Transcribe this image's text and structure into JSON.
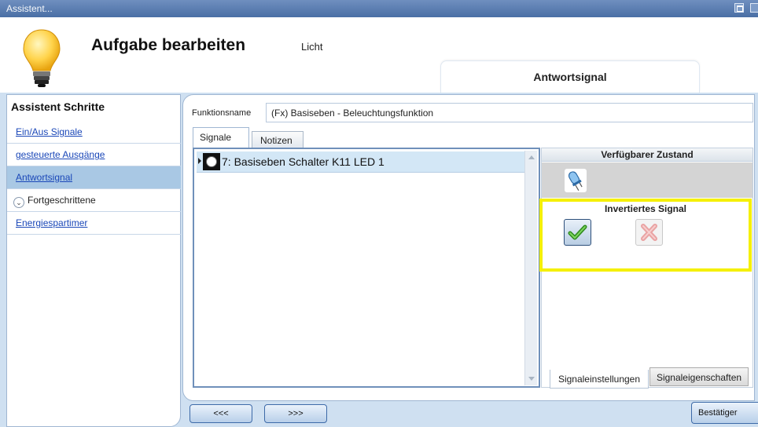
{
  "window": {
    "title": "Assistent..."
  },
  "header": {
    "title": "Aufgabe bearbeiten",
    "subtitle": "Licht",
    "active_step_tab": "Antwortsignal"
  },
  "sidebar": {
    "heading": "Assistent Schritte",
    "items": [
      {
        "label": "Ein/Aus Signale",
        "type": "link"
      },
      {
        "label": "gesteuerte Ausgänge",
        "type": "link"
      },
      {
        "label": "Antwortsignal",
        "type": "link",
        "active": true
      },
      {
        "label": "Fortgeschrittene",
        "type": "expandable",
        "icon": "chevron-down-icon"
      },
      {
        "label": "Energiespartimer",
        "type": "link"
      }
    ]
  },
  "main": {
    "function_name_label": "Funktionsname",
    "function_name_value": "(Fx) Basiseben - Beleuchtungsfunktion",
    "tabs": [
      {
        "label": "Signale",
        "active": true
      },
      {
        "label": "Notizen",
        "active": false
      }
    ],
    "signal_list": [
      {
        "label": "7: Basiseben Schalter K11 LED 1",
        "icon": "led-signal-icon"
      }
    ]
  },
  "right_panel": {
    "header": "Verfügbarer Zustand",
    "state_icon": "led-icon",
    "inverted_signal_title": "Invertiertes Signal",
    "inverted_options": [
      {
        "icon": "checkmark-icon",
        "selected": true
      },
      {
        "icon": "x-icon",
        "selected": false
      }
    ],
    "tabs": [
      {
        "label": "Signaleinstellungen",
        "active": true
      },
      {
        "label": "Signaleigenschaften",
        "active": false
      }
    ]
  },
  "footer": {
    "prev_label": "<<<",
    "next_label": ">>>",
    "confirm_label": "Bestätiger"
  },
  "colors": {
    "highlight_border": "#f5f000",
    "active_nav": "#a9c8e4",
    "link": "#1a47b8",
    "row_selected": "#d3e7f6"
  }
}
